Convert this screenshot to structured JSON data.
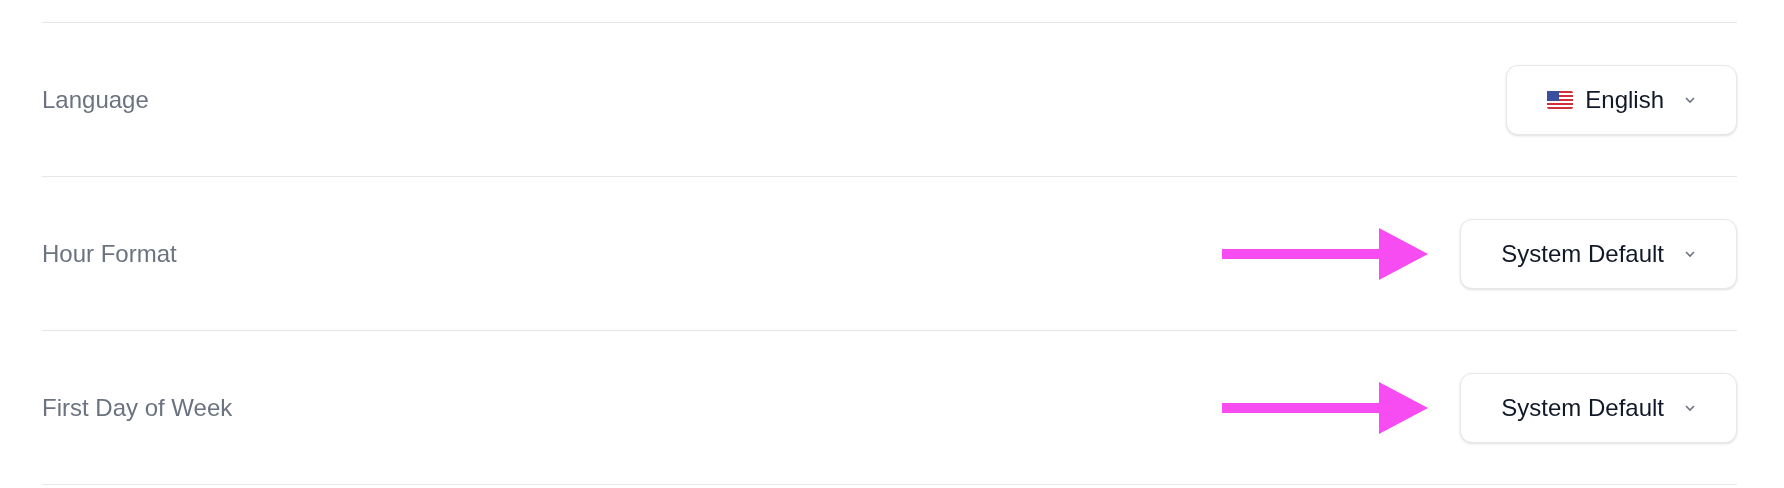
{
  "settings": [
    {
      "label": "Language",
      "value": "English",
      "kind": "flag",
      "annotated": false
    },
    {
      "label": "Hour Format",
      "value": "System Default",
      "kind": "plain",
      "annotated": true
    },
    {
      "label": "First Day of Week",
      "value": "System Default",
      "kind": "plain",
      "annotated": true
    }
  ]
}
